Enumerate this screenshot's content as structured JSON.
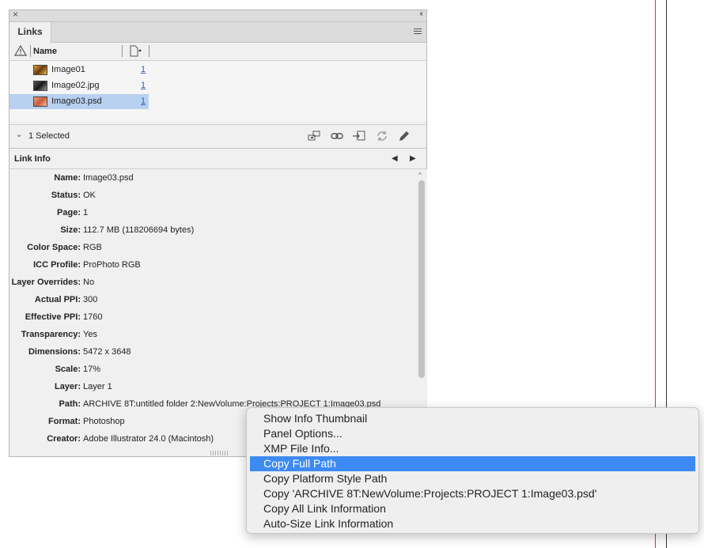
{
  "panel": {
    "tab_label": "Links",
    "column_name_label": "Name",
    "links": [
      {
        "name": "Image01",
        "page": "1",
        "thumb_color": "#8a5a2a",
        "selected": false
      },
      {
        "name": "Image02.jpg",
        "page": "1",
        "thumb_color": "#3a3a3a",
        "selected": false
      },
      {
        "name": "Image03.psd",
        "page": "1",
        "thumb_color": "#d87850",
        "selected": true
      }
    ],
    "selected_text": "1 Selected",
    "link_info_title": "Link Info",
    "info": [
      {
        "label": "Name:",
        "value": "Image03.psd"
      },
      {
        "label": "Status:",
        "value": "OK"
      },
      {
        "label": "Page:",
        "value": "1"
      },
      {
        "label": "Size:",
        "value": "112.7 MB (118206694 bytes)"
      },
      {
        "label": "Color Space:",
        "value": "RGB"
      },
      {
        "label": "ICC Profile:",
        "value": "ProPhoto RGB"
      },
      {
        "label": "Layer Overrides:",
        "value": "No"
      },
      {
        "label": "Actual PPI:",
        "value": "300"
      },
      {
        "label": "Effective PPI:",
        "value": "1760"
      },
      {
        "label": "Transparency:",
        "value": "Yes"
      },
      {
        "label": "Dimensions:",
        "value": "5472 x 3648"
      },
      {
        "label": "Scale:",
        "value": "17%"
      },
      {
        "label": "Layer:",
        "value": "Layer 1"
      },
      {
        "label": "Path:",
        "value": "ARCHIVE 8T:untitled folder 2:NewVolume:Projects:PROJECT 1:Image03.psd"
      },
      {
        "label": "Format:",
        "value": "Photoshop"
      },
      {
        "label": "Creator:",
        "value": "Adobe Illustrator 24.0 (Macintosh)"
      }
    ]
  },
  "context_menu": {
    "items": [
      "Show Info Thumbnail",
      "Panel Options...",
      "XMP File Info...",
      "Copy Full Path",
      "Copy Platform Style Path",
      "Copy 'ARCHIVE 8T:NewVolume:Projects:PROJECT 1:Image03.psd'",
      "Copy All Link Information",
      "Auto-Size Link Information"
    ],
    "highlighted": "Copy Full Path"
  },
  "colors": {
    "selection": "#b9d1f0",
    "menu_highlight": "#3d8bf2",
    "link_blue": "#2a62c9",
    "guide_red": "#e0304a"
  }
}
